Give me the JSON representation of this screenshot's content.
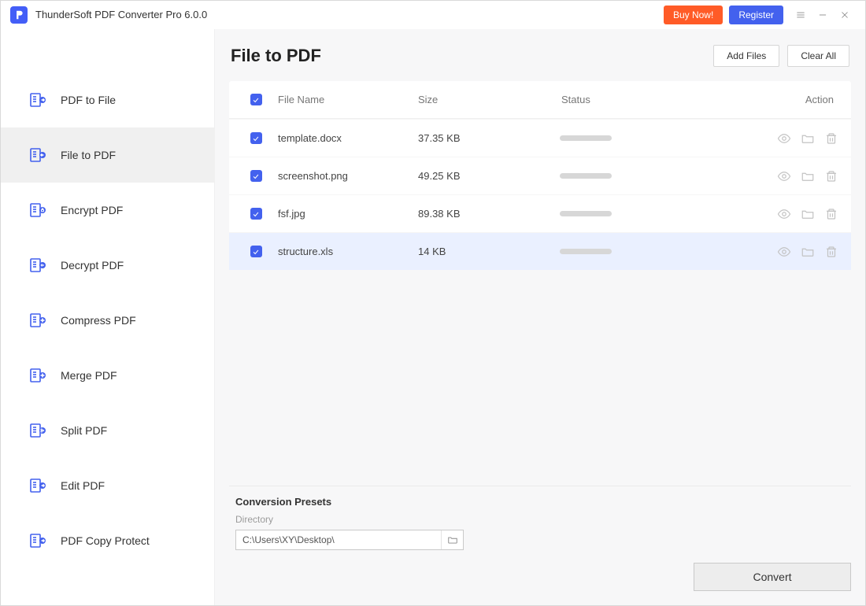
{
  "app": {
    "title": "ThunderSoft PDF Converter Pro 6.0.0"
  },
  "header": {
    "buy_label": "Buy Now!",
    "register_label": "Register"
  },
  "sidebar": {
    "items": [
      {
        "id": "pdf-to-file",
        "label": "PDF to File"
      },
      {
        "id": "file-to-pdf",
        "label": "File to PDF"
      },
      {
        "id": "encrypt-pdf",
        "label": "Encrypt PDF"
      },
      {
        "id": "decrypt-pdf",
        "label": "Decrypt PDF"
      },
      {
        "id": "compress-pdf",
        "label": "Compress PDF"
      },
      {
        "id": "merge-pdf",
        "label": "Merge PDF"
      },
      {
        "id": "split-pdf",
        "label": "Split PDF"
      },
      {
        "id": "edit-pdf",
        "label": "Edit PDF"
      },
      {
        "id": "pdf-copy-protect",
        "label": "PDF Copy Protect"
      }
    ],
    "active_index": 1
  },
  "main": {
    "title": "File to PDF",
    "add_files_label": "Add Files",
    "clear_all_label": "Clear All",
    "columns": {
      "file_name": "File Name",
      "size": "Size",
      "status": "Status",
      "action": "Action"
    },
    "rows": [
      {
        "checked": true,
        "name": "template.docx",
        "size": "37.35 KB",
        "hovered": false
      },
      {
        "checked": true,
        "name": "screenshot.png",
        "size": "49.25 KB",
        "hovered": false
      },
      {
        "checked": true,
        "name": "fsf.jpg",
        "size": "89.38 KB",
        "hovered": false
      },
      {
        "checked": true,
        "name": "structure.xls",
        "size": "14 KB",
        "hovered": true
      }
    ]
  },
  "presets": {
    "title": "Conversion Presets",
    "directory_label": "Directory",
    "directory_value": "C:\\Users\\XY\\Desktop\\"
  },
  "actions": {
    "convert_label": "Convert"
  }
}
